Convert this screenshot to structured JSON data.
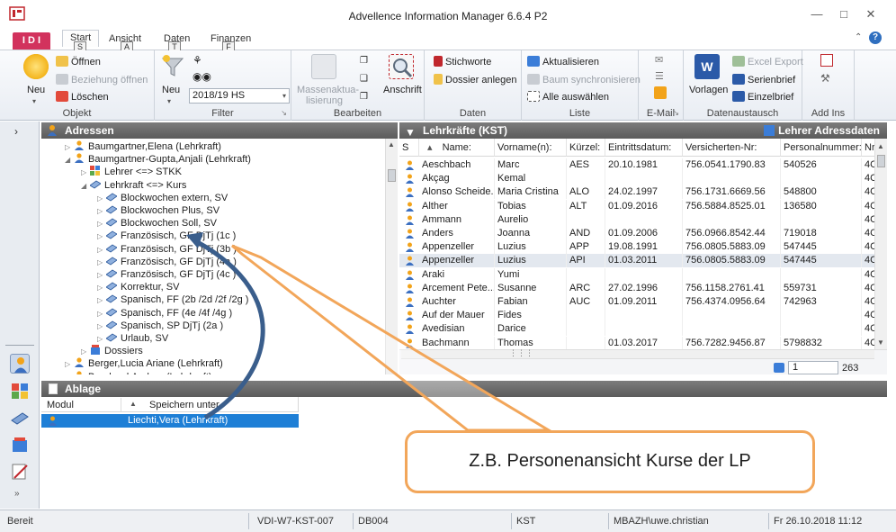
{
  "window": {
    "title": "Advellence Information Manager 6.6.4 P2",
    "app_badge": "I D I"
  },
  "tabs": [
    {
      "label": "Start",
      "key": "S"
    },
    {
      "label": "Ansicht",
      "key": "A"
    },
    {
      "label": "Daten",
      "key": "T"
    },
    {
      "label": "Finanzen",
      "key": "F"
    }
  ],
  "ribbon": {
    "objekt": {
      "label": "Objekt",
      "neu": "Neu",
      "oeffnen": "Öffnen",
      "beziehung": "Beziehung öffnen",
      "loeschen": "Löschen"
    },
    "filter": {
      "label": "Filter",
      "neu": "Neu",
      "semester": "2018/19 HS"
    },
    "bearbeiten": {
      "label": "Bearbeiten",
      "massen": "Massenaktua-",
      "massen2": "lisierung",
      "anschrift": "Anschrift"
    },
    "daten": {
      "label": "Daten",
      "stichworte": "Stichworte",
      "dossier": "Dossier anlegen"
    },
    "liste": {
      "label": "Liste",
      "aktualisieren": "Aktualisieren",
      "baum": "Baum synchronisieren",
      "alle": "Alle auswählen"
    },
    "email": {
      "label": "E-Mail"
    },
    "datenaustausch": {
      "label": "Datenaustausch",
      "vorlagen": "Vorlagen",
      "excel": "Excel Export",
      "serienbrief": "Serienbrief",
      "einzelbrief": "Einzelbrief"
    },
    "addins": {
      "label": "Add Ins"
    }
  },
  "adressen": {
    "title": "Adressen",
    "tree": [
      {
        "label": "Baumgartner,Elena (Lehrkraft)",
        "level": 0,
        "type": "person",
        "expanded": false
      },
      {
        "label": "Baumgartner-Gupta,Anjali (Lehrkraft)",
        "level": 0,
        "type": "person",
        "expanded": true
      },
      {
        "label": "Lehrer <=> STKK",
        "level": 1,
        "type": "group",
        "expanded": false
      },
      {
        "label": "Lehrkraft <=> Kurs",
        "level": 1,
        "type": "course",
        "expanded": true
      },
      {
        "label": "Blockwochen extern, SV",
        "level": 2,
        "type": "course",
        "expanded": false
      },
      {
        "label": "Blockwochen Plus, SV",
        "level": 2,
        "type": "course",
        "expanded": false
      },
      {
        "label": "Blockwochen Soll, SV",
        "level": 2,
        "type": "course",
        "expanded": false
      },
      {
        "label": "Französisch, GF DjTj (1c )",
        "level": 2,
        "type": "course",
        "expanded": false
      },
      {
        "label": "Französisch, GF DjTj (3b )",
        "level": 2,
        "type": "course",
        "expanded": false
      },
      {
        "label": "Französisch, GF DjTj (4a )",
        "level": 2,
        "type": "course",
        "expanded": false
      },
      {
        "label": "Französisch, GF DjTj (4c )",
        "level": 2,
        "type": "course",
        "expanded": false
      },
      {
        "label": "Korrektur, SV",
        "level": 2,
        "type": "course",
        "expanded": false
      },
      {
        "label": "Spanisch, FF (2b /2d /2f /2g )",
        "level": 2,
        "type": "course",
        "expanded": false
      },
      {
        "label": "Spanisch, FF (4e /4f /4g )",
        "level": 2,
        "type": "course",
        "expanded": false
      },
      {
        "label": "Spanisch, SP DjTj (2a )",
        "level": 2,
        "type": "course",
        "expanded": false
      },
      {
        "label": "Urlaub, SV",
        "level": 2,
        "type": "course",
        "expanded": false
      },
      {
        "label": "Dossiers",
        "level": 1,
        "type": "dossier",
        "expanded": false
      },
      {
        "label": "Berger,Lucia Ariane (Lehrkraft)",
        "level": 0,
        "type": "person",
        "expanded": false
      },
      {
        "label": "Bernhard,Andrea (Lehrkraft)",
        "level": 0,
        "type": "person",
        "expanded": false
      }
    ]
  },
  "lehrkraefte": {
    "title": "Lehrkräfte (KST)",
    "right_title": "Lehrer Adressdaten",
    "columns": [
      "S",
      "Name:",
      "Vorname(n):",
      "Kürzel:",
      "Eintrittsdatum:",
      "Versicherten-Nr:",
      "Personalnummer:",
      "Nr"
    ],
    "rows": [
      [
        "Aeschbach",
        "Marc",
        "AES",
        "20.10.1981",
        "756.0541.1790.83",
        "540526",
        "4C"
      ],
      [
        "Akçag",
        "Kemal",
        "",
        "",
        "",
        "",
        "4C"
      ],
      [
        "Alonso Scheide...",
        "Maria Cristina",
        "ALO",
        "24.02.1997",
        "756.1731.6669.56",
        "548800",
        "4C"
      ],
      [
        "Alther",
        "Tobias",
        "ALT",
        "01.09.2016",
        "756.5884.8525.01",
        "136580",
        "4C"
      ],
      [
        "Ammann",
        "Aurelio",
        "",
        "",
        "",
        "",
        "4C"
      ],
      [
        "Anders",
        "Joanna",
        "AND",
        "01.09.2006",
        "756.0966.8542.44",
        "719018",
        "4C"
      ],
      [
        "Appenzeller",
        "Luzius",
        "APP",
        "19.08.1991",
        "756.0805.5883.09",
        "547445",
        "4C"
      ],
      [
        "Appenzeller",
        "Luzius",
        "API",
        "01.03.2011",
        "756.0805.5883.09",
        "547445",
        "4C"
      ],
      [
        "Araki",
        "Yumi",
        "",
        "",
        "",
        "",
        "4C"
      ],
      [
        "Arcement Pete...",
        "Susanne",
        "ARC",
        "27.02.1996",
        "756.1158.2761.41",
        "559731",
        "4C"
      ],
      [
        "Auchter",
        "Fabian",
        "AUC",
        "01.09.2011",
        "756.4374.0956.64",
        "742963",
        "4C"
      ],
      [
        "Auf der Mauer",
        "Fides",
        "",
        "",
        "",
        "",
        "4C"
      ],
      [
        "Avedisian",
        "Darice",
        "",
        "",
        "",
        "",
        "4C"
      ],
      [
        "Bachmann",
        "Thomas",
        "",
        "01.03.2017",
        "756.7282.9456.87",
        "5798832",
        "4C"
      ]
    ],
    "page": "1",
    "total": "263"
  },
  "ablage": {
    "title": "Ablage",
    "col_modul": "Modul",
    "col_speichern": "Speichern unter",
    "entry": "Liechti,Vera (Lehrkraft)"
  },
  "status": {
    "ready": "Bereit",
    "server": "VDI-W7-KST-007",
    "db": "DB004",
    "kst": "KST",
    "user": "MBAZH\\uwe.christian",
    "datetime": "Fr 26.10.2018 11:12"
  },
  "callout": {
    "text": "Z.B. Personenansicht Kurse der LP"
  },
  "colors": {
    "accent": "#d2325d",
    "callout_border": "#f2a65a",
    "arrow": "#3a5e8c",
    "header": "#6b6b6b"
  }
}
